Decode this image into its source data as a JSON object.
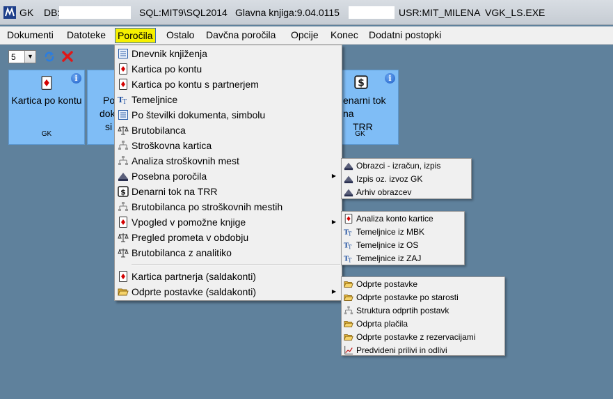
{
  "titlebar": {
    "app": "GK",
    "db_label": "DB:",
    "sql": "SQL:MIT9\\SQL2014",
    "ledger": "Glavna knjiga:9.04.0115",
    "user": "USR:MIT_MILENA",
    "exe": "VGK_LS.EXE"
  },
  "menubar": {
    "items": [
      "Dokumenti",
      "Datoteke",
      "Poročila",
      "Ostalo",
      "Davčna poročila",
      "Opcije",
      "Konec",
      "Dodatni postopki"
    ]
  },
  "toolbar": {
    "page_value": "5"
  },
  "tiles": [
    {
      "label_l1": "Kartica po kontu",
      "label_l2": "",
      "footer": "GK",
      "icon": "card-icon"
    },
    {
      "label_l1": "Po",
      "label_l2": "dok",
      "label_l3": "si",
      "footer": "",
      "icon": ""
    },
    {
      "label_l1": "enarni tok na",
      "label_l2": "TRR",
      "footer": "GK",
      "icon": "dollar-icon"
    }
  ],
  "colors": {
    "background": "#5f819c",
    "tile": "#7fbdf6",
    "menu": "#f0f0f0",
    "highlight": "#f6f000"
  },
  "dropdown": {
    "items": [
      {
        "label": "Dnevnik knjiženja",
        "icon": "journal-icon"
      },
      {
        "label": "Kartica po kontu",
        "icon": "card-icon"
      },
      {
        "label": "Kartica po kontu s partnerjem",
        "icon": "card-icon"
      },
      {
        "label": "Temeljnice",
        "icon": "text-tt-icon"
      },
      {
        "label": "Po številki dokumenta, simbolu",
        "icon": "journal-icon"
      },
      {
        "label": "Brutobilanca",
        "icon": "scale-icon"
      },
      {
        "label": "Stroškovna kartica",
        "icon": "tree-icon"
      },
      {
        "label": "Analiza stroškovnih mest",
        "icon": "tree-icon"
      },
      {
        "label": "Posebna poročila",
        "icon": "durs-icon"
      },
      {
        "label": "Denarni tok na TRR",
        "icon": "dollar-icon"
      },
      {
        "label": "Brutobilanca po stroškovnih mestih",
        "icon": "tree-icon"
      },
      {
        "label": "Vpogled v pomožne knjige",
        "icon": "card-icon"
      },
      {
        "label": "Pregled prometa v obdobju",
        "icon": "scale-icon"
      },
      {
        "label": "Brutobilanca z analitiko",
        "icon": "scale-icon"
      },
      {
        "label": "Kartica partnerja (saldakonti)",
        "icon": "card-icon"
      },
      {
        "label": "Odprte postavke (saldakonti)",
        "icon": "folder-open-icon"
      }
    ]
  },
  "submenu_posebna": {
    "items": [
      {
        "label": "Obrazci - izračun, izpis",
        "icon": "durs-icon"
      },
      {
        "label": "Izpis oz. izvoz GK",
        "icon": "durs-icon"
      },
      {
        "label": "Arhiv obrazcev",
        "icon": "durs-icon"
      }
    ]
  },
  "submenu_vpogled": {
    "items": [
      {
        "label": "Analiza konto kartice",
        "icon": "card-icon"
      },
      {
        "label": "Temeljnice iz MBK",
        "icon": "text-tt-icon"
      },
      {
        "label": "Temeljnice iz OS",
        "icon": "text-tt-icon"
      },
      {
        "label": "Temeljnice iz ZAJ",
        "icon": "text-tt-icon"
      }
    ]
  },
  "submenu_odprte": {
    "items": [
      {
        "label": "Odprte postavke",
        "icon": "folder-open-icon"
      },
      {
        "label": "Odprte postavke po starosti",
        "icon": "folder-open-icon"
      },
      {
        "label": "Struktura odprtih postavk",
        "icon": "tree-icon"
      },
      {
        "label": "Odprta plačila",
        "icon": "folder-open-icon"
      },
      {
        "label": "Odprte postavke z rezervacijami",
        "icon": "folder-open-icon"
      },
      {
        "label": "Predvideni prilivi in odlivi",
        "icon": "line-chart-icon"
      }
    ]
  }
}
